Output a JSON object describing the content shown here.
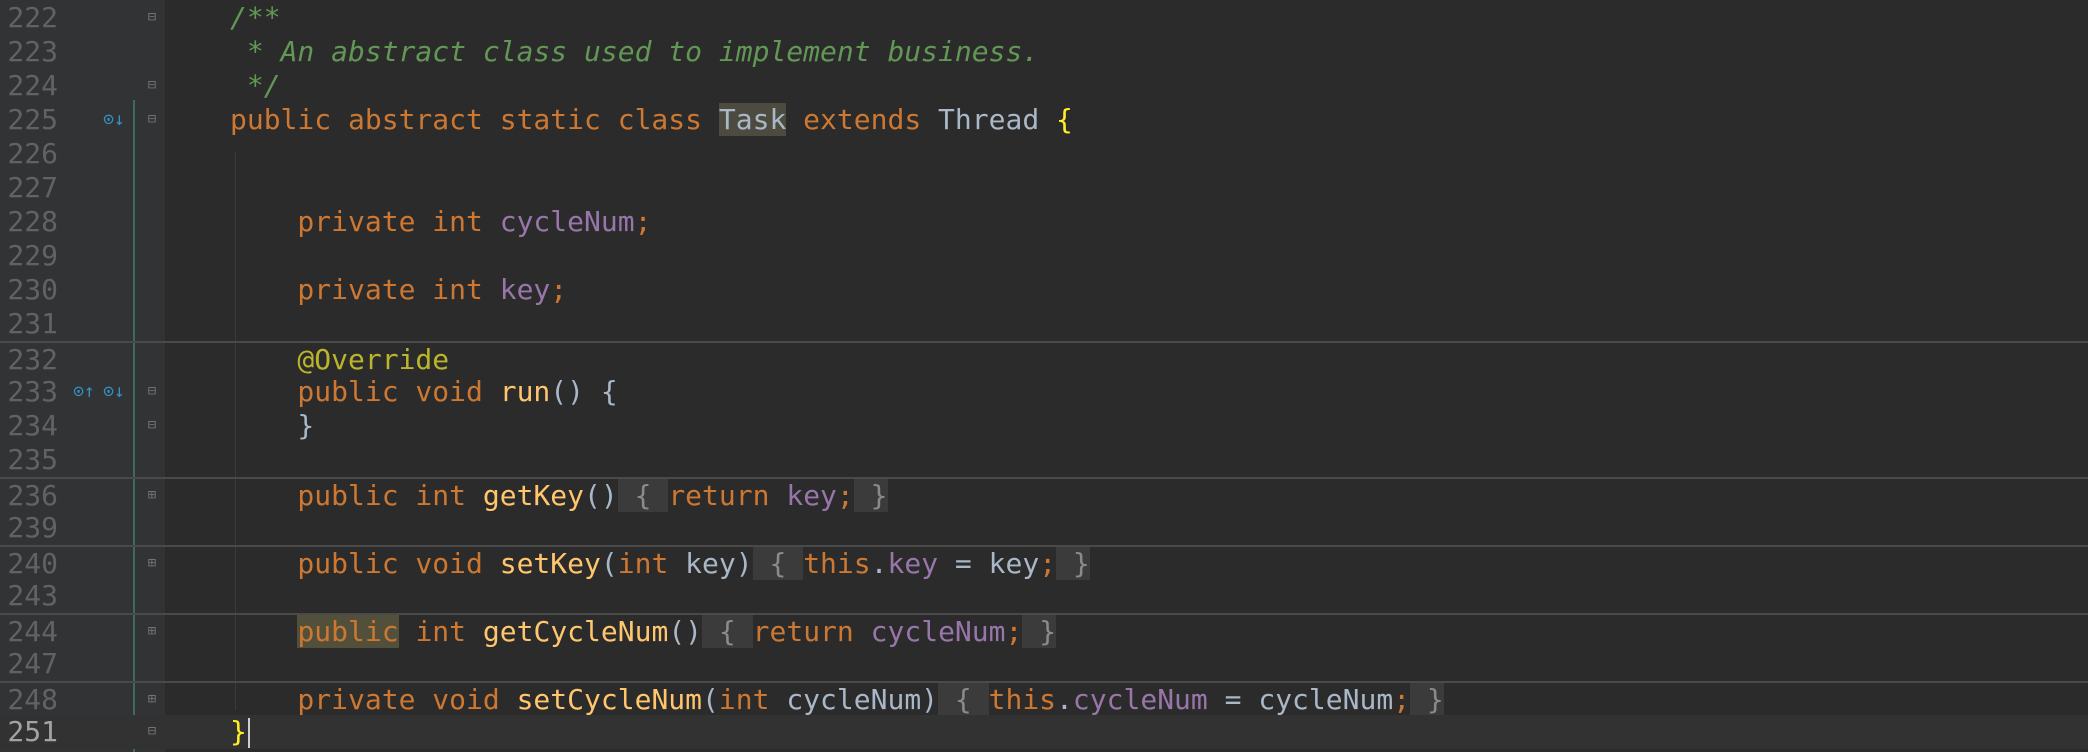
{
  "lines": [
    {
      "num": "222",
      "tokens": [
        {
          "t": "/**",
          "c": "cmt"
        }
      ]
    },
    {
      "num": "223",
      "tokens": [
        {
          "t": " * An abstract class used to implement business.",
          "c": "cmt"
        }
      ]
    },
    {
      "num": "224",
      "tokens": [
        {
          "t": " */",
          "c": "cmt"
        }
      ]
    },
    {
      "num": "225",
      "tokens": [
        {
          "t": "public abstract static class ",
          "c": "kw"
        },
        {
          "t": "Task",
          "c": "hl-task"
        },
        {
          "t": " extends ",
          "c": "kw"
        },
        {
          "t": "Thread ",
          "c": "txt"
        },
        {
          "t": "{",
          "c": "brace-match"
        }
      ]
    },
    {
      "num": "226",
      "tokens": []
    },
    {
      "num": "227",
      "tokens": []
    },
    {
      "num": "228",
      "tokens": [
        {
          "t": "    private int ",
          "c": "kw"
        },
        {
          "t": "cycleNum",
          "c": "fld"
        },
        {
          "t": ";",
          "c": "kw"
        }
      ]
    },
    {
      "num": "229",
      "tokens": []
    },
    {
      "num": "230",
      "tokens": [
        {
          "t": "    private int ",
          "c": "kw"
        },
        {
          "t": "key",
          "c": "fld"
        },
        {
          "t": ";",
          "c": "kw"
        }
      ]
    },
    {
      "num": "231",
      "tokens": []
    },
    {
      "num": "232",
      "tokens": [
        {
          "t": "    @Override",
          "c": "anno"
        }
      ]
    },
    {
      "num": "233",
      "tokens": [
        {
          "t": "    public void ",
          "c": "kw"
        },
        {
          "t": "run",
          "c": "meth"
        },
        {
          "t": "() {",
          "c": "txt"
        }
      ]
    },
    {
      "num": "234",
      "tokens": [
        {
          "t": "    }",
          "c": "txt"
        }
      ]
    },
    {
      "num": "235",
      "tokens": []
    },
    {
      "num": "236",
      "tokens": [
        {
          "t": "    public int ",
          "c": "kw"
        },
        {
          "t": "getKey",
          "c": "meth"
        },
        {
          "t": "()",
          "c": "txt"
        },
        {
          "t": " { ",
          "c": "fold-chip"
        },
        {
          "t": "return ",
          "c": "kw"
        },
        {
          "t": "key",
          "c": "fld"
        },
        {
          "t": ";",
          "c": "kw"
        },
        {
          "t": " }",
          "c": "fold-chip"
        }
      ]
    },
    {
      "num": "239",
      "tokens": []
    },
    {
      "num": "240",
      "tokens": [
        {
          "t": "    public void ",
          "c": "kw"
        },
        {
          "t": "setKey",
          "c": "meth"
        },
        {
          "t": "(",
          "c": "txt"
        },
        {
          "t": "int ",
          "c": "kw"
        },
        {
          "t": "key)",
          "c": "txt"
        },
        {
          "t": " { ",
          "c": "fold-chip"
        },
        {
          "t": "this",
          "c": "kw"
        },
        {
          "t": ".",
          "c": "txt"
        },
        {
          "t": "key",
          "c": "fld"
        },
        {
          "t": " = key",
          "c": "txt"
        },
        {
          "t": ";",
          "c": "kw"
        },
        {
          "t": " }",
          "c": "fold-chip"
        }
      ]
    },
    {
      "num": "243",
      "tokens": []
    },
    {
      "num": "244",
      "tokens": [
        {
          "t": "    ",
          "c": "txt"
        },
        {
          "t": "public",
          "c": "kw usage-hl"
        },
        {
          "t": " int ",
          "c": "kw"
        },
        {
          "t": "getCycleNum",
          "c": "meth"
        },
        {
          "t": "()",
          "c": "txt"
        },
        {
          "t": " { ",
          "c": "fold-chip"
        },
        {
          "t": "return ",
          "c": "kw"
        },
        {
          "t": "cycleNum",
          "c": "fld"
        },
        {
          "t": ";",
          "c": "kw"
        },
        {
          "t": " }",
          "c": "fold-chip"
        }
      ]
    },
    {
      "num": "247",
      "tokens": []
    },
    {
      "num": "248",
      "tokens": [
        {
          "t": "    private void ",
          "c": "kw"
        },
        {
          "t": "setCycleNum",
          "c": "meth"
        },
        {
          "t": "(",
          "c": "txt"
        },
        {
          "t": "int ",
          "c": "kw"
        },
        {
          "t": "cycleNum)",
          "c": "txt"
        },
        {
          "t": " { ",
          "c": "fold-chip"
        },
        {
          "t": "this",
          "c": "kw"
        },
        {
          "t": ".",
          "c": "txt"
        },
        {
          "t": "cycleNum",
          "c": "fld"
        },
        {
          "t": " = cycleNum",
          "c": "txt"
        },
        {
          "t": ";",
          "c": "kw"
        },
        {
          "t": " }",
          "c": "fold-chip"
        }
      ]
    },
    {
      "num": "251",
      "tokens": [
        {
          "t": "}",
          "c": "brace-match"
        }
      ]
    }
  ],
  "current_line": "251",
  "separator_lines": [
    "232",
    "236",
    "240",
    "244",
    "248"
  ],
  "fold_markers": {
    "222": "open",
    "224": "close",
    "225": "open",
    "233": "open",
    "234": "close",
    "236": "collapsed",
    "240": "collapsed",
    "244": "collapsed",
    "248": "collapsed",
    "251": "close"
  },
  "gutter_icons": {
    "225": [
      "implemented-down-icon"
    ],
    "233": [
      "overrides-up-icon",
      "implemented-down-icon"
    ]
  },
  "colors": {
    "background": "#2b2b2b",
    "gutter": "#313335",
    "keyword": "#cc7832",
    "field": "#9876aa",
    "method": "#ffc66d",
    "comment": "#629755",
    "annotation": "#bbb529",
    "text": "#a9b7c6",
    "brace_match": "#ffef28"
  }
}
